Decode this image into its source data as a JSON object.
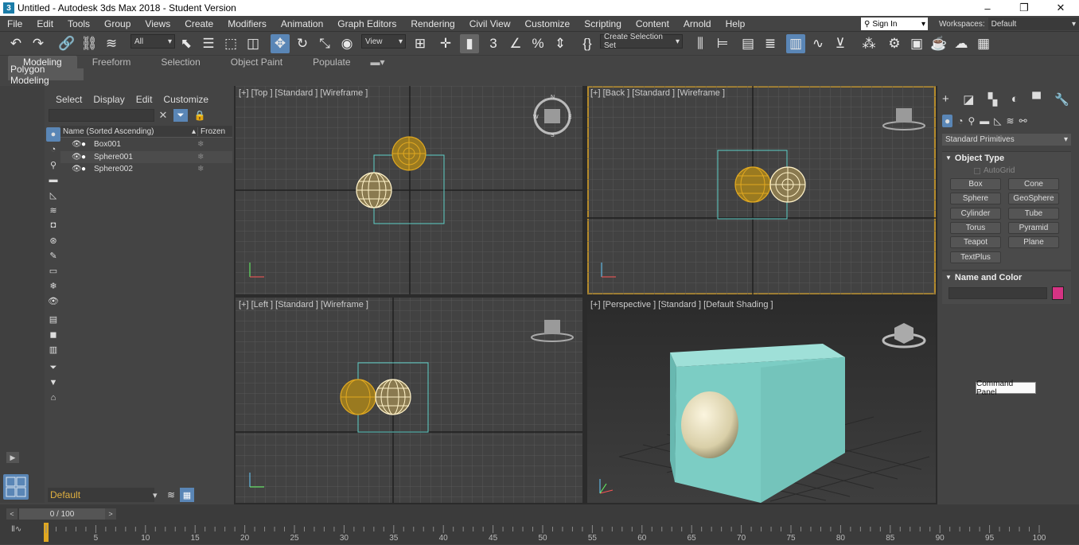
{
  "window": {
    "title": "Untitled - Autodesk 3ds Max 2018 - Student Version",
    "minimize": "–",
    "restore": "❐",
    "close": "✕"
  },
  "menu": [
    "File",
    "Edit",
    "Tools",
    "Group",
    "Views",
    "Create",
    "Modifiers",
    "Animation",
    "Graph Editors",
    "Rendering",
    "Civil View",
    "Customize",
    "Scripting",
    "Content",
    "Arnold",
    "Help"
  ],
  "account": {
    "signin_label": "Sign In",
    "workspaces_label": "Workspaces:",
    "workspace_value": "Default"
  },
  "toolbar": {
    "selection_filter": "All",
    "reference_coord": "View",
    "selection_set": "Create Selection Set"
  },
  "ribbon": {
    "tabs": [
      "Modeling",
      "Freeform",
      "Selection",
      "Object Paint",
      "Populate"
    ],
    "panel_label": "Polygon Modeling"
  },
  "scene_explorer": {
    "menu": [
      "Select",
      "Display",
      "Edit",
      "Customize"
    ],
    "col_name": "Name (Sorted Ascending)",
    "col_frozen": "Frozen",
    "rows": [
      {
        "name": "Box001"
      },
      {
        "name": "Sphere001"
      },
      {
        "name": "Sphere002"
      }
    ],
    "layer": "Default"
  },
  "viewports": {
    "top": {
      "label": "[+] [Top ] [Standard ] [Wireframe ]"
    },
    "back": {
      "label": "[+] [Back ] [Standard ] [Wireframe ]"
    },
    "left": {
      "label": "[+] [Left ] [Standard ] [Wireframe ]"
    },
    "perspective": {
      "label": "[+] [Perspective ] [Standard ] [Default Shading ]"
    }
  },
  "command_panel": {
    "category": "Standard Primitives",
    "object_type_title": "Object Type",
    "autogrid": "AutoGrid",
    "buttons": [
      "Box",
      "Cone",
      "Sphere",
      "GeoSphere",
      "Cylinder",
      "Tube",
      "Torus",
      "Pyramid",
      "Teapot",
      "Plane",
      "TextPlus"
    ],
    "name_color_title": "Name and Color",
    "color_swatch": "#d63383",
    "tooltip": "Command Panel"
  },
  "time": {
    "slider_label": "0 / 100",
    "ticks": [
      5,
      10,
      15,
      20,
      25,
      30,
      35,
      40,
      45,
      50,
      55,
      60,
      65,
      70,
      75,
      80,
      85,
      90,
      95,
      100
    ]
  },
  "colors": {
    "accent_blue": "#5a86b6",
    "active_viewport": "#b68b2a",
    "box_color": "#7ed0c6",
    "selected_wire": "#c89a2a"
  }
}
